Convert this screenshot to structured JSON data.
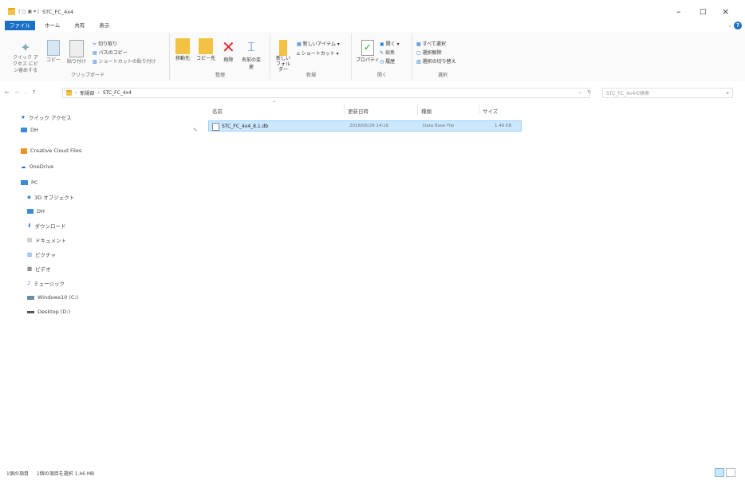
{
  "window": {
    "title": "STC_FC_4x4",
    "controls": {
      "minimize": "–",
      "maximize": "□",
      "close": "×"
    }
  },
  "ribbon": {
    "tabs": [
      "ファイル",
      "ホーム",
      "共有",
      "表示"
    ],
    "active_tab": "ファイル",
    "clipboard": {
      "label": "クリップボード",
      "pin": "クイック アクセス にピン留めする",
      "copy": "コピー",
      "paste": "貼り付け",
      "cut": "切り取り",
      "copy_path": "パスのコピー",
      "paste_shortcut": "ショートカットの貼り付け"
    },
    "organize": {
      "label": "整理",
      "move_to": "移動先",
      "copy_to": "コピー先",
      "delete": "削除",
      "rename": "名前の変更"
    },
    "new": {
      "label": "新規",
      "new_folder": "新しい フォルダー",
      "new_item": "新しいアイテム",
      "shortcut": "ショートカット"
    },
    "open": {
      "label": "開く",
      "properties": "プロパティ",
      "open": "開く",
      "edit": "編集",
      "history": "履歴"
    },
    "select": {
      "label": "選択",
      "select_all": "すべて選択",
      "select_none": "選択解除",
      "invert": "選択の切り替え"
    }
  },
  "addressbar": {
    "path": [
      "新規部",
      "STC_FC_4x4"
    ],
    "search_placeholder": "STC_FC_4x4の検索"
  },
  "sidebar": {
    "items": [
      {
        "label": "クイック アクセス",
        "icon": "star-icon"
      },
      {
        "label": "DH",
        "icon": "drive-icon"
      },
      {
        "label": "Creative Cloud Files",
        "icon": "folder-icon"
      },
      {
        "label": "OneDrive",
        "icon": "cloud-icon"
      },
      {
        "label": "PC",
        "icon": "pc-icon"
      },
      {
        "label": "3D オブジェクト",
        "icon": "3d-icon"
      },
      {
        "label": "DH",
        "icon": "drive-icon"
      },
      {
        "label": "ダウンロード",
        "icon": "download-icon"
      },
      {
        "label": "ドキュメント",
        "icon": "document-icon"
      },
      {
        "label": "ピクチャ",
        "icon": "picture-icon"
      },
      {
        "label": "ビデオ",
        "icon": "video-icon"
      },
      {
        "label": "ミュージック",
        "icon": "music-icon"
      },
      {
        "label": "Windows10 (C:)",
        "icon": "disk-icon"
      },
      {
        "label": "Desktop (D:)",
        "icon": "disk-icon"
      }
    ]
  },
  "filelist": {
    "columns": [
      "名前",
      "更新日時",
      "種類",
      "サイズ"
    ],
    "rows": [
      {
        "name": "STC_FC_4x4_8.1.db",
        "modified": "2018/06/28 14:16",
        "type": "Data Base File",
        "size": "1.46 KB"
      }
    ]
  },
  "statusbar": {
    "count": "1個の項目",
    "selected": "1個の項目を選択 1.46 MB"
  },
  "colors": {
    "accent": "#1a6fc7",
    "selection": "#cce8ff",
    "folder": "#f3c243"
  }
}
